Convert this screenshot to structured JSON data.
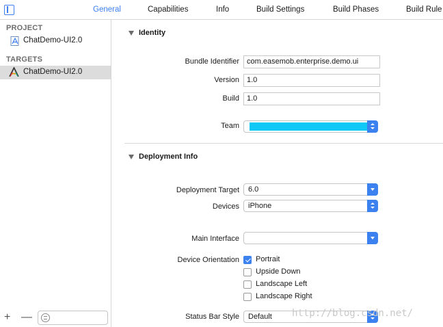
{
  "tabs": [
    {
      "label": "General"
    },
    {
      "label": "Capabilities"
    },
    {
      "label": "Info"
    },
    {
      "label": "Build Settings"
    },
    {
      "label": "Build Phases"
    },
    {
      "label": "Build Rule"
    }
  ],
  "sidebar": {
    "project_header": "PROJECT",
    "project_item": "ChatDemo-UI2.0",
    "targets_header": "TARGETS",
    "target_item": "ChatDemo-UI2.0",
    "add_symbol": "+",
    "remove_symbol": "—"
  },
  "identity": {
    "title": "Identity",
    "bundle_identifier_label": "Bundle Identifier",
    "bundle_identifier_value": "com.easemob.enterprise.demo.ui",
    "version_label": "Version",
    "version_value": "1.0",
    "build_label": "Build",
    "build_value": "1.0",
    "team_label": "Team"
  },
  "deployment": {
    "title": "Deployment Info",
    "target_label": "Deployment Target",
    "target_value": "6.0",
    "devices_label": "Devices",
    "devices_value": "iPhone",
    "main_interface_label": "Main Interface",
    "main_interface_value": "",
    "orientation_label": "Device Orientation",
    "orientations": [
      {
        "label": "Portrait",
        "checked": true
      },
      {
        "label": "Upside Down",
        "checked": false
      },
      {
        "label": "Landscape Left",
        "checked": false
      },
      {
        "label": "Landscape Right",
        "checked": false
      }
    ],
    "status_bar_label": "Status Bar Style",
    "status_bar_value": "Default"
  },
  "watermark": "http://blog.csdn.net/",
  "colors": {
    "accent": "#3b82f0",
    "team_redaction": "#0fc8f5"
  }
}
